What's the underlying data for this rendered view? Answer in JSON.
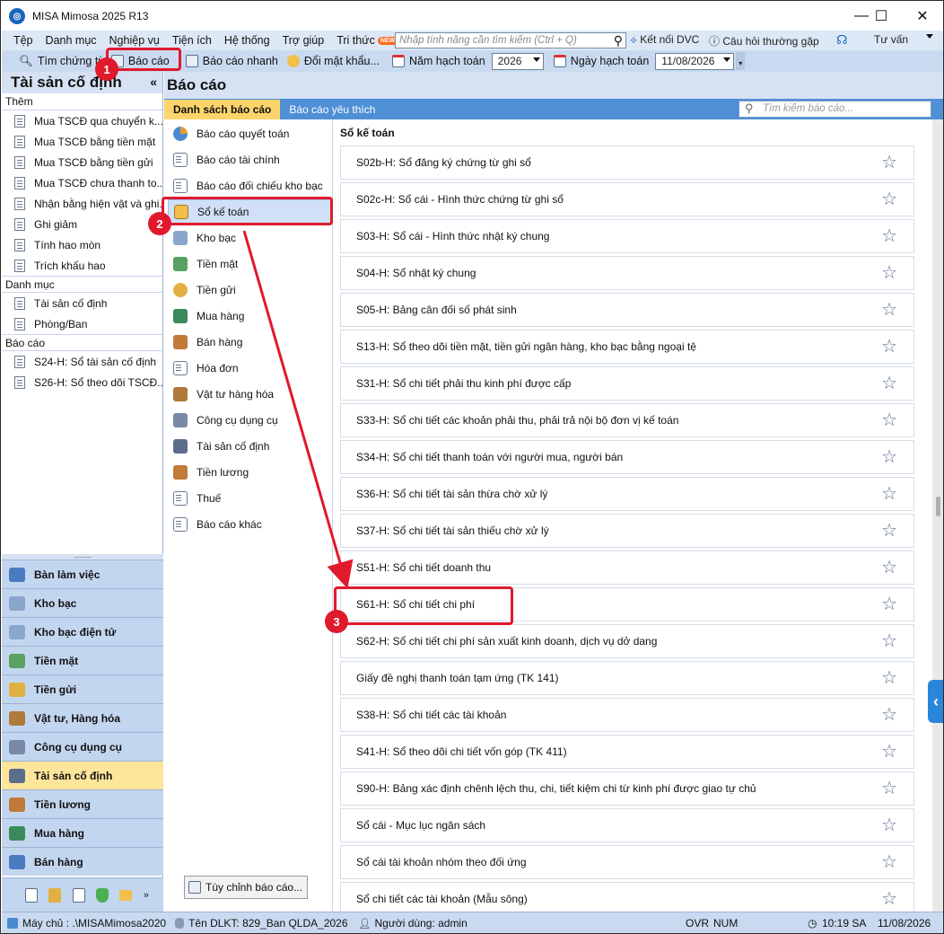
{
  "window": {
    "title": "MISA Mimosa 2025 R13",
    "minimize_glyph": "—",
    "maximize_glyph": "☐",
    "close_glyph": "✕"
  },
  "menu": {
    "items": [
      "Tệp",
      "Danh mục",
      "Nghiệp vụ",
      "Tiện ích",
      "Hệ thống",
      "Trợ giúp",
      "Tri thức"
    ],
    "new_badge": "NEW",
    "search_placeholder": "Nhập tính năng cần tìm kiếm (Ctrl + Q)",
    "connect_dvc": "Kết nối DVC",
    "faq": "Câu hỏi thường gặp",
    "consult": "Tư vấn"
  },
  "toolbar": {
    "find_voucher": "Tìm chứng từ",
    "reports": "Báo cáo",
    "quick_report": "Báo cáo nhanh",
    "change_password": "Đổi mật khẩu...",
    "fiscal_year_label": "Năm hạch toán",
    "fiscal_year_value": "2026",
    "posting_date_label": "Ngày hạch toán",
    "posting_date_value": "11/08/2026"
  },
  "left_panel": {
    "title": "Tài sản cố định",
    "collapse_glyph": "«",
    "add_section": "Thêm",
    "add_items": [
      "Mua TSCĐ qua chuyển k...",
      "Mua TSCĐ bằng tiền mặt",
      "Mua TSCĐ bằng tiền gửi",
      "Mua TSCĐ chưa thanh to...",
      "Nhận bằng hiện vật và ghi...",
      "Ghi giảm",
      "Tính hao mòn",
      "Trích khấu hao"
    ],
    "catalog_section": "Danh mục",
    "catalog_items": [
      "Tài sản cố định",
      "Phòng/Ban"
    ],
    "report_section": "Báo cáo",
    "report_items": [
      "S24-H: Sổ tài sản cố định",
      "S26-H: Sổ theo dõi TSCĐ..."
    ],
    "divider_dots": "........."
  },
  "nav_buttons": [
    "Bàn làm việc",
    "Kho bạc",
    "Kho bạc điện tử",
    "Tiền mặt",
    "Tiền gửi",
    "Vật tư, Hàng hóa",
    "Công cụ dụng cụ",
    "Tài sản cố định",
    "Tiền lương",
    "Mua hàng",
    "Bán hàng"
  ],
  "nav_active": "Tài sản cố định",
  "main": {
    "title": "Báo cáo",
    "tab_list": "Danh sách báo cáo",
    "tab_favorites": "Báo cáo yêu thích",
    "search_placeholder": "Tìm kiếm báo cáo...",
    "categories": [
      "Báo cáo quyết toán",
      "Báo cáo tài chính",
      "Báo cáo đối chiếu kho bạc",
      "Sổ kế toán",
      "Kho bạc",
      "Tiền mặt",
      "Tiền gửi",
      "Mua hàng",
      "Bán hàng",
      "Hóa đơn",
      "Vật tư hàng hóa",
      "Công cụ dụng cụ",
      "Tài sản cố định",
      "Tiền lương",
      "Thuế",
      "Báo cáo khác"
    ],
    "selected_category": "Sổ kế toán",
    "customize_button": "Tùy chỉnh báo cáo...",
    "section_title": "Sổ kế toán",
    "reports": [
      "S02b-H: Sổ đăng ký chứng từ ghi sổ",
      "S02c-H: Sổ cái - Hình thức chứng từ ghi sổ",
      "S03-H: Sổ cái - Hình thức nhật ký chung",
      "S04-H: Sổ nhật ký chung",
      "S05-H: Bảng cân đối số phát sinh",
      "S13-H: Sổ theo dõi tiền mặt, tiền gửi ngân hàng, kho bạc bằng ngoại tệ",
      "S31-H: Sổ chi tiết phải thu kinh phí được cấp",
      "S33-H: Sổ chi tiết các khoản phải thu, phải trả nội bộ đơn vị kế toán",
      "S34-H: Sổ chi tiết thanh toán với người mua, người bán",
      "S36-H: Sổ chi tiết tài sản thừa chờ xử lý",
      "S37-H: Sổ chi tiết tài sản thiếu chờ xử lý",
      "S51-H: Sổ chi tiết doanh thu",
      "S61-H: Sổ chi tiết chi phí",
      "S62-H: Sổ chi tiết chi phí sản xuất kinh doanh, dịch vụ dở dang",
      "Giấy đề nghị thanh toán tạm ứng (TK 141)",
      "S38-H: Sổ chi tiết các tài khoản",
      "S41-H: Sổ theo dõi chi tiết vốn góp (TK 411)",
      "S90-H: Bảng xác định chênh lệch thu, chi, tiết kiệm chi từ kinh phí được giao tự chủ",
      "Sổ cái - Mục lục ngân sách",
      "Sổ cái tài khoản nhóm theo đối ứng",
      "Sổ chi tiết các tài khoản (Mẫu sông)"
    ],
    "star_glyph": "☆",
    "side_tab_glyph": "‹"
  },
  "status": {
    "server": "Máy chủ : .\\MISAMimosa2020",
    "database": "Tên DLKT: 829_Ban QLDA_2026",
    "user": "Người dùng: admin",
    "ovr": "OVR",
    "num": "NUM",
    "time": "10:19 SA",
    "date": "11/08/2026"
  },
  "annotations": [
    "1",
    "2",
    "3"
  ],
  "colors": {
    "accent": "#4e8fd6",
    "highlight": "#fbd56b",
    "annotation": "#e0192d"
  }
}
